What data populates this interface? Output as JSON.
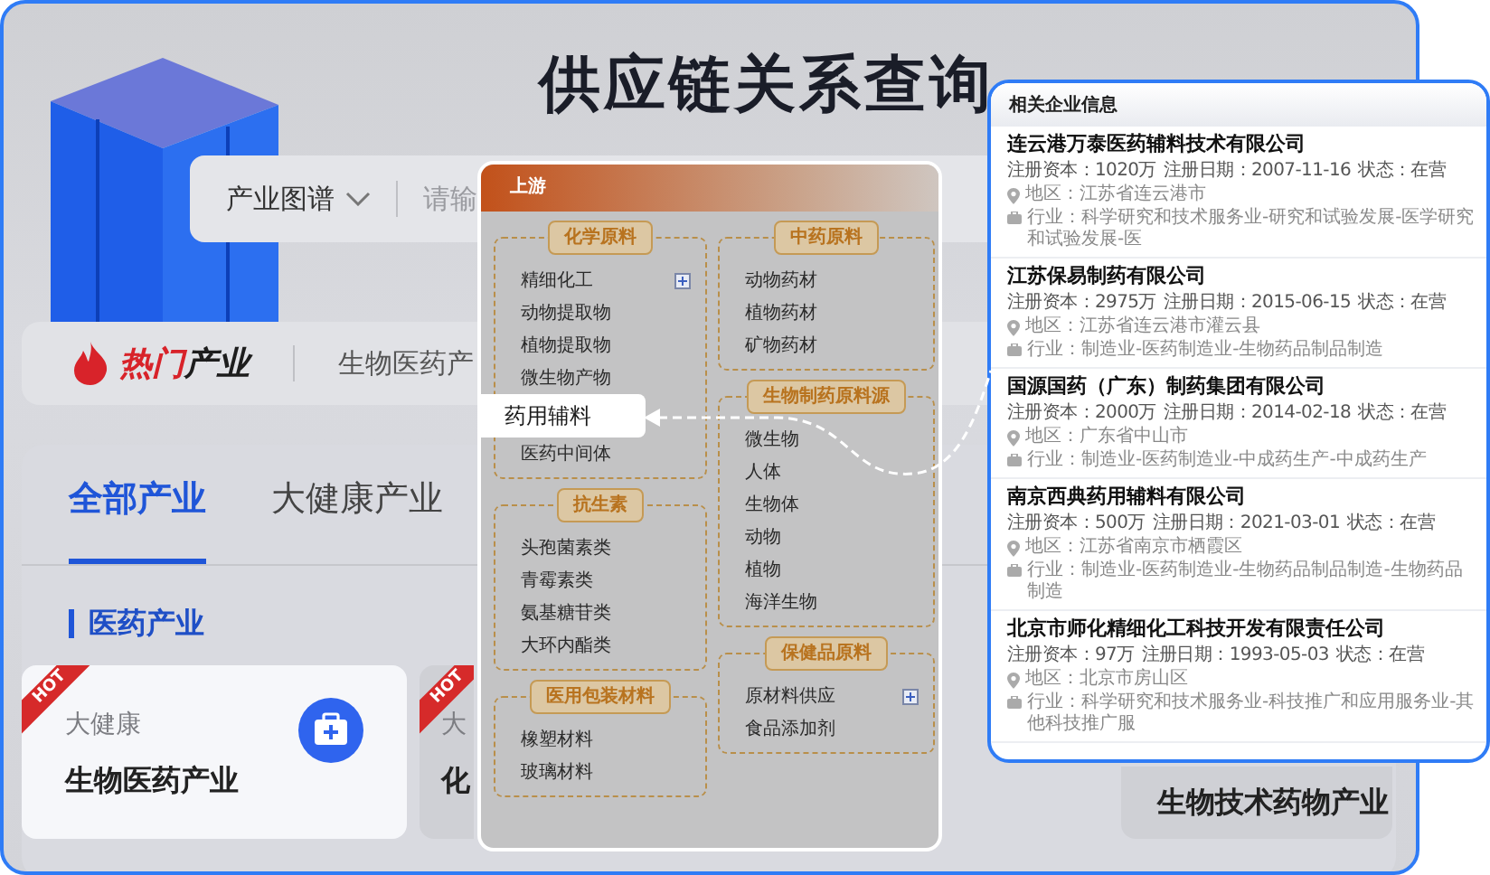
{
  "title": "供应链关系查询",
  "search": {
    "category": "产业图谱",
    "placeholder": "请输"
  },
  "hot_bar": {
    "label_parts": [
      {
        "text": "热门",
        "kind": "accent"
      },
      {
        "text": "产业",
        "kind": "plain"
      }
    ],
    "items": [
      "生物医药产"
    ]
  },
  "tabs": [
    {
      "label": "全部产业",
      "selected": true
    },
    {
      "label": "大健康产业",
      "selected": false
    }
  ],
  "section": {
    "title": "医药产业",
    "cards": [
      {
        "category": "大健康",
        "name": "生物医药产业",
        "badge": "HOT",
        "selected": true
      },
      {
        "category": "大",
        "name": "化",
        "badge": "HOT",
        "selected": false
      },
      {
        "name": "生物技术药物产业",
        "selected": false
      }
    ]
  },
  "upstream": {
    "title": "上游",
    "columns": [
      [
        {
          "title": "化学原料",
          "items": [
            {
              "label": "精细化工",
              "expandable": true,
              "selected": false
            },
            {
              "label": "动物提取物",
              "expandable": false,
              "selected": false
            },
            {
              "label": "植物提取物",
              "expandable": false,
              "selected": false
            },
            {
              "label": "微生物产物",
              "expandable": false,
              "selected": false
            },
            {
              "label": "药用辅料",
              "expandable": false,
              "selected": true
            },
            {
              "label": "医药中间体",
              "expandable": false,
              "selected": false
            }
          ]
        },
        {
          "title": "抗生素",
          "items": [
            {
              "label": "头孢菌素类",
              "expandable": false,
              "selected": false
            },
            {
              "label": "青霉素类",
              "expandable": false,
              "selected": false
            },
            {
              "label": "氨基糖苷类",
              "expandable": false,
              "selected": false
            },
            {
              "label": "大环内酯类",
              "expandable": false,
              "selected": false
            }
          ]
        },
        {
          "title": "医用包装材料",
          "items": [
            {
              "label": "橡塑材料",
              "expandable": false,
              "selected": false
            },
            {
              "label": "玻璃材料",
              "expandable": false,
              "selected": false
            }
          ]
        }
      ],
      [
        {
          "title": "中药原料",
          "items": [
            {
              "label": "动物药材",
              "expandable": false,
              "selected": false
            },
            {
              "label": "植物药材",
              "expandable": false,
              "selected": false
            },
            {
              "label": "矿物药材",
              "expandable": false,
              "selected": false
            }
          ]
        },
        {
          "title": "生物制药原料源",
          "items": [
            {
              "label": "微生物",
              "expandable": false,
              "selected": false
            },
            {
              "label": "人体",
              "expandable": false,
              "selected": false
            },
            {
              "label": "生物体",
              "expandable": false,
              "selected": false
            },
            {
              "label": "动物",
              "expandable": false,
              "selected": false
            },
            {
              "label": "植物",
              "expandable": false,
              "selected": false
            },
            {
              "label": "海洋生物",
              "expandable": false,
              "selected": false
            }
          ]
        },
        {
          "title": "保健品原料",
          "items": [
            {
              "label": "原材料供应",
              "expandable": true,
              "selected": false
            },
            {
              "label": "食品添加剂",
              "expandable": false,
              "selected": false
            }
          ]
        }
      ]
    ]
  },
  "companies_panel": {
    "title": "相关企业信息",
    "companies": [
      {
        "name": "连云港万泰医药辅料技术有限公司",
        "capital": "注册资本：1020万",
        "date": "注册日期：2007-11-16",
        "status": "状态：在营",
        "region": "地区：江苏省连云港市",
        "industry": "行业：科学研究和技术服务业-研究和试验发展-医学研究和试验发展-医"
      },
      {
        "name": "江苏保易制药有限公司",
        "capital": "注册资本：2975万",
        "date": "注册日期：2015-06-15",
        "status": "状态：在营",
        "region": "地区：江苏省连云港市灌云县",
        "industry": "行业：制造业-医药制造业-生物药品制品制造"
      },
      {
        "name": "国源国药（广东）制药集团有限公司",
        "capital": "注册资本：2000万",
        "date": "注册日期：2014-02-18",
        "status": "状态：在营",
        "region": "地区：广东省中山市",
        "industry": "行业：制造业-医药制造业-中成药生产-中成药生产"
      },
      {
        "name": "南京西典药用辅料有限公司",
        "capital": "注册资本：500万",
        "date": "注册日期：2021-03-01",
        "status": "状态：在营",
        "region": "地区：江苏省南京市栖霞区",
        "industry": "行业：制造业-医药制造业-生物药品制品制造-生物药品制造"
      },
      {
        "name": "北京市师化精细化工科技开发有限责任公司",
        "capital": "注册资本：97万",
        "date": "注册日期：1993-05-03",
        "status": "状态：在营",
        "region": "地区：北京市房山区",
        "industry": "行业：科学研究和技术服务业-科技推广和应用服务业-其他科技推广服"
      }
    ]
  }
}
